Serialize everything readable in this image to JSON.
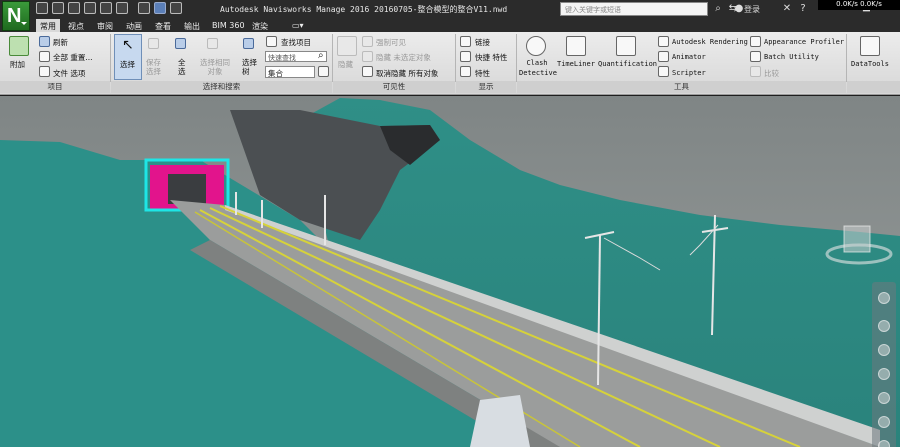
{
  "window": {
    "title": "Autodesk Navisworks Manage 2016     20160705-整合模型的整合V11.nwd",
    "search_placeholder": "键入关键字或短语",
    "login_label": "登录",
    "network_badge": "0.0K/s  0.0K/s"
  },
  "tabs": [
    {
      "label": "常用",
      "active": true
    },
    {
      "label": "视点"
    },
    {
      "label": "审阅"
    },
    {
      "label": "动画"
    },
    {
      "label": "查看"
    },
    {
      "label": "输出"
    },
    {
      "label": "BIM 360"
    },
    {
      "label": "渲染"
    }
  ],
  "ribbon": {
    "project": {
      "title": "项目",
      "append": "附加",
      "refresh": "刷新",
      "reset_all": "全部 重置...",
      "file_options": "文件 选项"
    },
    "select_search": {
      "title": "选择和搜索",
      "select": "选择",
      "save_selection": "保存选择",
      "select_all": "全选",
      "select_same": "选择相同对象",
      "selection_tree": "选择树",
      "find_items": "查找项目",
      "quick_find": "快速查找",
      "sets": "集合"
    },
    "visibility": {
      "title": "可见性",
      "hide": "隐藏",
      "require": "强制可见",
      "hide_unselected": "隐藏 未选定对象",
      "unhide_all": "取消隐藏 所有对象"
    },
    "display": {
      "title": "显示",
      "links": "链接",
      "quick_properties": "快捷 特性",
      "properties": "特性"
    },
    "tools": {
      "title": "工具",
      "clash_detective": "Clash Detective",
      "timeliner": "TimeLiner",
      "quantification": "Quantification",
      "autodesk_rendering": "Autodesk Rendering",
      "animator": "Animator",
      "scripter": "Scripter",
      "appearance_profiler": "Appearance Profiler",
      "batch_utility": "Batch Utility",
      "compare": "比较",
      "datatools": "DataTools"
    }
  },
  "colors": {
    "ribbon_bg": "#e4e4e4",
    "title_bg": "#2b2b2b",
    "sky": "#8c9191",
    "terrain": "#2e9c92",
    "tunnel_portal": "#e2148c",
    "rail_yellow": "#d6d23a"
  }
}
